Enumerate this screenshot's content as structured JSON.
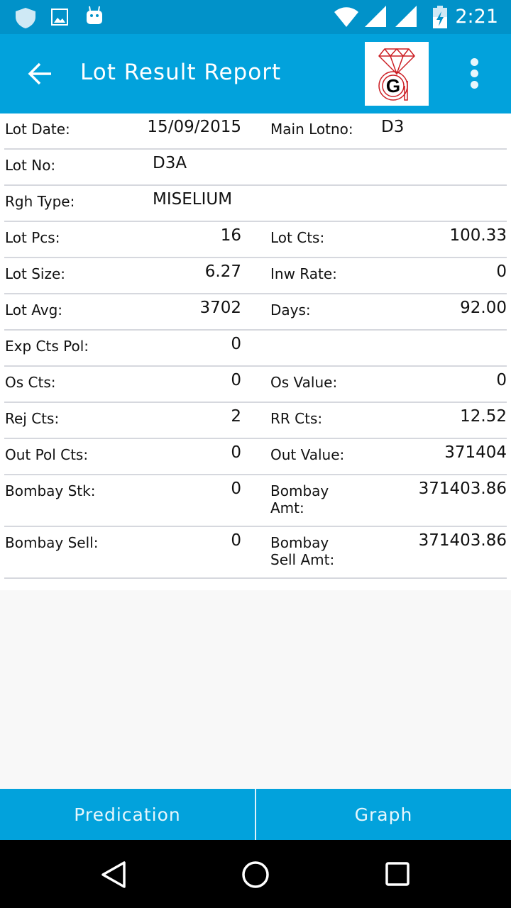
{
  "status_bar": {
    "time": "2:21",
    "icons": [
      "shield-icon",
      "image-icon",
      "android-icon",
      "wifi-icon",
      "signal-icon",
      "signal-icon",
      "battery-charging-icon"
    ]
  },
  "app_bar": {
    "title": "Lot Result Report",
    "back_icon": "arrow-left-icon",
    "logo": "G diamond logo",
    "menu_icon": "more-vertical-icon"
  },
  "colors": {
    "primary": "#02a2dc",
    "status": "#0192c9",
    "logo_red": "#cc1f24"
  },
  "rows": [
    {
      "label1": "Lot Date:",
      "value1": "15/09/2015",
      "align1": "r",
      "label2": "Main Lotno:",
      "value2": "D3",
      "align2": "l"
    },
    {
      "label1": "Lot No:",
      "value1": "D3A",
      "align1": "l",
      "label2": "",
      "value2": ""
    },
    {
      "label1": "Rgh Type:",
      "value1": "MISELIUM",
      "align1": "l",
      "label2": "",
      "value2": ""
    },
    {
      "label1": "Lot Pcs:",
      "value1": "16",
      "label2": "Lot Cts:",
      "value2": "100.33"
    },
    {
      "label1": "Lot Size:",
      "value1": "6.27",
      "label2": "Inw Rate:",
      "value2": "0"
    },
    {
      "label1": "Lot Avg:",
      "value1": "3702",
      "label2": "Days:",
      "value2": "92.00"
    },
    {
      "label1": "Exp Cts Pol:",
      "value1": "0",
      "label2": "",
      "value2": ""
    },
    {
      "label1": "Os Cts:",
      "value1": "0",
      "label2": "Os Value:",
      "value2": "0"
    },
    {
      "label1": "Rej Cts:",
      "value1": "2",
      "label2": "RR Cts:",
      "value2": "12.52"
    },
    {
      "label1": "Out Pol Cts:",
      "value1": "0",
      "label2": "Out Value:",
      "value2": "371404"
    },
    {
      "label1": "Bombay Stk:",
      "value1": "0",
      "label2": "Bombay Amt:",
      "value2": "371403.86",
      "tall": true
    },
    {
      "label1": "Bombay Sell:",
      "value1": "0",
      "label2": "Bombay Sell Amt:",
      "value2": "371403.86",
      "tall": true
    }
  ],
  "buttons": {
    "predication": "Predication",
    "graph": "Graph"
  }
}
